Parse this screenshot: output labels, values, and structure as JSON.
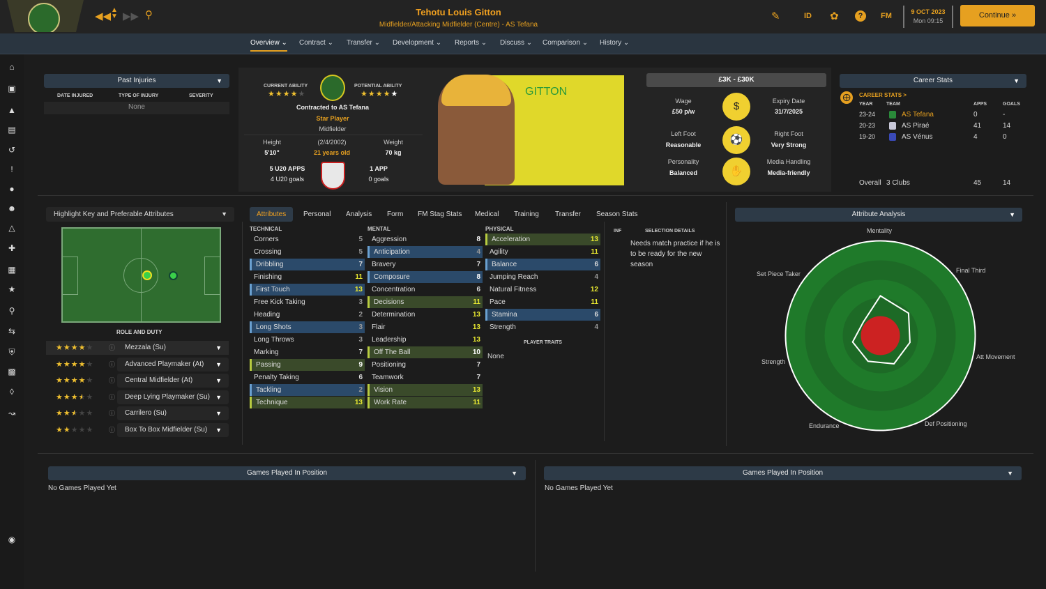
{
  "header": {
    "player_name": "Tehotu Louis Gitton",
    "player_subtitle": "Midfielder/Attacking Midfielder (Centre) - AS Tefana",
    "date_day": "9 OCT 2023",
    "date_time": "Mon 09:15",
    "id_label": "ID",
    "fm_label": "FM",
    "continue_label": "Continue"
  },
  "nav": {
    "tabs": [
      "Overview",
      "Contract",
      "Transfer",
      "Development",
      "Reports",
      "Discuss",
      "Comparison",
      "History"
    ]
  },
  "injuries": {
    "title": "Past Injuries",
    "cols": [
      "DATE INJURED",
      "TYPE OF INJURY",
      "SEVERITY"
    ],
    "empty": "None"
  },
  "profile": {
    "ca_label": "CURRENT ABILITY",
    "pa_label": "POTENTIAL ABILITY",
    "ca_stars": 4,
    "pa_stars": 5,
    "contract": "Contracted to AS Tefana",
    "status": "Star Player",
    "position": "Midfielder",
    "height_label": "Height",
    "height": "5'10\"",
    "dob": "(2/4/2002)",
    "age": "21 years old",
    "weight_label": "Weight",
    "weight": "70 kg",
    "u20_apps": "5 U20 APPS",
    "u20_goals": "4 U20 goals",
    "apps": "1 APP",
    "goals": "0 goals",
    "shirt_name": "GITTON"
  },
  "contract_box": {
    "value_range": "£3K - £30K",
    "wage_label": "Wage",
    "wage": "£50 p/w",
    "expiry_label": "Expiry Date",
    "expiry": "31/7/2025",
    "left_foot_label": "Left Foot",
    "left_foot": "Reasonable",
    "right_foot_label": "Right Foot",
    "right_foot": "Very Strong",
    "personality_label": "Personality",
    "personality": "Balanced",
    "media_label": "Media Handling",
    "media": "Media-friendly"
  },
  "career": {
    "title": "Career Stats",
    "link": "CAREER STATS >",
    "cols": [
      "YEAR",
      "TEAM",
      "APPS",
      "GOALS"
    ],
    "rows": [
      {
        "year": "23-24",
        "team": "AS Tefana",
        "apps": "0",
        "goals": "-"
      },
      {
        "year": "20-23",
        "team": "AS Piraé",
        "apps": "41",
        "goals": "14"
      },
      {
        "year": "19-20",
        "team": "AS Vénus",
        "apps": "4",
        "goals": "0"
      }
    ],
    "overall_label": "Overall",
    "overall_clubs": "3 Clubs",
    "overall_apps": "45",
    "overall_goals": "14"
  },
  "highlight": {
    "title": "Highlight Key and Preferable Attributes",
    "role_title": "ROLE AND DUTY"
  },
  "roles": [
    {
      "name": "Mezzala (Su)",
      "stars": 4.0
    },
    {
      "name": "Advanced Playmaker (At)",
      "stars": 4.0
    },
    {
      "name": "Central Midfielder (At)",
      "stars": 4.0
    },
    {
      "name": "Deep Lying Playmaker (Su)",
      "stars": 3.5
    },
    {
      "name": "Carrilero (Su)",
      "stars": 2.5
    },
    {
      "name": "Box To Box Midfielder (Su)",
      "stars": 2.0
    }
  ],
  "attr_tabs": [
    "Attributes",
    "Personal",
    "Analysis",
    "Form",
    "FM Stag Stats",
    "Medical",
    "Training",
    "Transfer",
    "Season Stats"
  ],
  "attributes": {
    "technical_title": "TECHNICAL",
    "mental_title": "MENTAL",
    "physical_title": "PHYSICAL",
    "technical": [
      {
        "n": "Corners",
        "v": "5",
        "h": ""
      },
      {
        "n": "Crossing",
        "v": "5",
        "h": ""
      },
      {
        "n": "Dribbling",
        "v": "7",
        "h": "blue"
      },
      {
        "n": "Finishing",
        "v": "11",
        "h": ""
      },
      {
        "n": "First Touch",
        "v": "13",
        "h": "blue"
      },
      {
        "n": "Free Kick Taking",
        "v": "3",
        "h": ""
      },
      {
        "n": "Heading",
        "v": "2",
        "h": ""
      },
      {
        "n": "Long Shots",
        "v": "3",
        "h": "blue"
      },
      {
        "n": "Long Throws",
        "v": "3",
        "h": ""
      },
      {
        "n": "Marking",
        "v": "7",
        "h": ""
      },
      {
        "n": "Passing",
        "v": "9",
        "h": "green"
      },
      {
        "n": "Penalty Taking",
        "v": "6",
        "h": ""
      },
      {
        "n": "Tackling",
        "v": "2",
        "h": "blue"
      },
      {
        "n": "Technique",
        "v": "13",
        "h": "green"
      }
    ],
    "mental": [
      {
        "n": "Aggression",
        "v": "8",
        "h": ""
      },
      {
        "n": "Anticipation",
        "v": "4",
        "h": "blue"
      },
      {
        "n": "Bravery",
        "v": "7",
        "h": ""
      },
      {
        "n": "Composure",
        "v": "8",
        "h": "blue"
      },
      {
        "n": "Concentration",
        "v": "6",
        "h": ""
      },
      {
        "n": "Decisions",
        "v": "11",
        "h": "green"
      },
      {
        "n": "Determination",
        "v": "13",
        "h": ""
      },
      {
        "n": "Flair",
        "v": "13",
        "h": ""
      },
      {
        "n": "Leadership",
        "v": "13",
        "h": ""
      },
      {
        "n": "Off The Ball",
        "v": "10",
        "h": "green"
      },
      {
        "n": "Positioning",
        "v": "7",
        "h": ""
      },
      {
        "n": "Teamwork",
        "v": "7",
        "h": ""
      },
      {
        "n": "Vision",
        "v": "13",
        "h": "green"
      },
      {
        "n": "Work Rate",
        "v": "11",
        "h": "green"
      }
    ],
    "physical": [
      {
        "n": "Acceleration",
        "v": "13",
        "h": "green"
      },
      {
        "n": "Agility",
        "v": "11",
        "h": ""
      },
      {
        "n": "Balance",
        "v": "6",
        "h": "blue"
      },
      {
        "n": "Jumping Reach",
        "v": "4",
        "h": ""
      },
      {
        "n": "Natural Fitness",
        "v": "12",
        "h": ""
      },
      {
        "n": "Pace",
        "v": "11",
        "h": ""
      },
      {
        "n": "Stamina",
        "v": "6",
        "h": "blue"
      },
      {
        "n": "Strength",
        "v": "4",
        "h": ""
      }
    ],
    "traits_title": "PLAYER TRAITS",
    "traits": "None"
  },
  "selection": {
    "inf": "INF",
    "title": "SELECTION DETAILS",
    "text": "Needs match practice if he is to be ready for the new season"
  },
  "analysis": {
    "title": "Attribute Analysis",
    "axes": [
      "Mentality",
      "Final Third",
      "Att Movement",
      "Def Positioning",
      "Endurance",
      "Strength",
      "Set Piece Taker"
    ],
    "values": [
      0.42,
      0.38,
      0.32,
      0.33,
      0.3,
      0.3,
      0.23
    ]
  },
  "games": {
    "title": "Games Played In Position",
    "empty": "No Games Played Yet"
  },
  "colors": {
    "accent": "#e6a020",
    "pitch": "#2f6d2f",
    "radar": "#1f7a2a",
    "radar_center": "#cc2222"
  }
}
